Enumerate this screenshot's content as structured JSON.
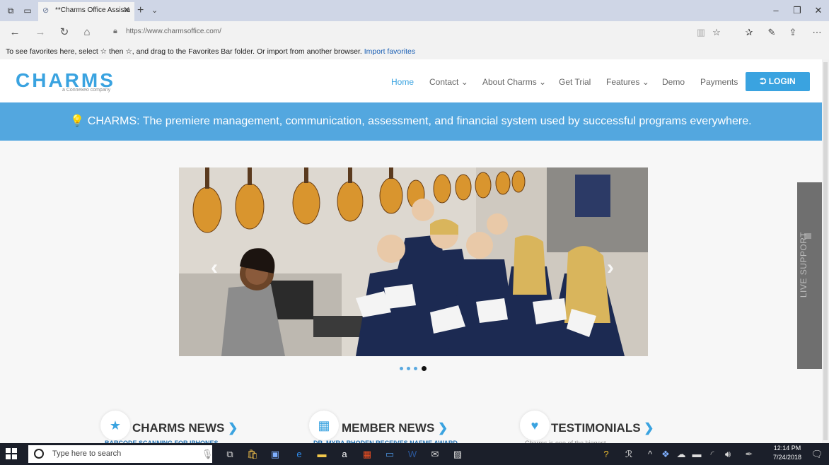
{
  "browser": {
    "tab_title": "**Charms Office Assista",
    "url": "https://www.charmsoffice.com/",
    "favorites_hint": "To see favorites here, select ☆ then ☆, and drag to the Favorites Bar folder. Or import from another browser.",
    "import_link": "Import favorites"
  },
  "site": {
    "logo": "CHARMS",
    "logo_sub": "a Connexeo company",
    "menu": {
      "home": "Home",
      "contact": "Contact ⌄",
      "about": "About Charms ⌄",
      "trial": "Get Trial",
      "features": "Features ⌄",
      "demo": "Demo",
      "payments": "Payments"
    },
    "login_label": "⮊ LOGIN",
    "banner": "💡 CHARMS: The premiere management, communication, assessment, and financial system used by successful programs everywhere.",
    "live_support": "LIVE SUPPORT",
    "sections": [
      {
        "title": "CHARMS NEWS",
        "sub": "BARCODE SCANNING FOR IPHONES"
      },
      {
        "title": "MEMBER NEWS",
        "sub": "DR. MYRA RHODEN RECEIVES NAFME AWARD"
      },
      {
        "title": "TESTIMONIALS",
        "sub": "Charms is one of the biggest ..."
      }
    ],
    "carousel": {
      "active_dot": 4,
      "dot_count": 4
    }
  },
  "taskbar": {
    "search_placeholder": "Type here to search",
    "time": "12:14 PM",
    "date": "7/24/2018"
  },
  "colors": {
    "accent": "#3aa3e0",
    "banner": "#53a7df",
    "taskbar": "#1b1f2a"
  }
}
